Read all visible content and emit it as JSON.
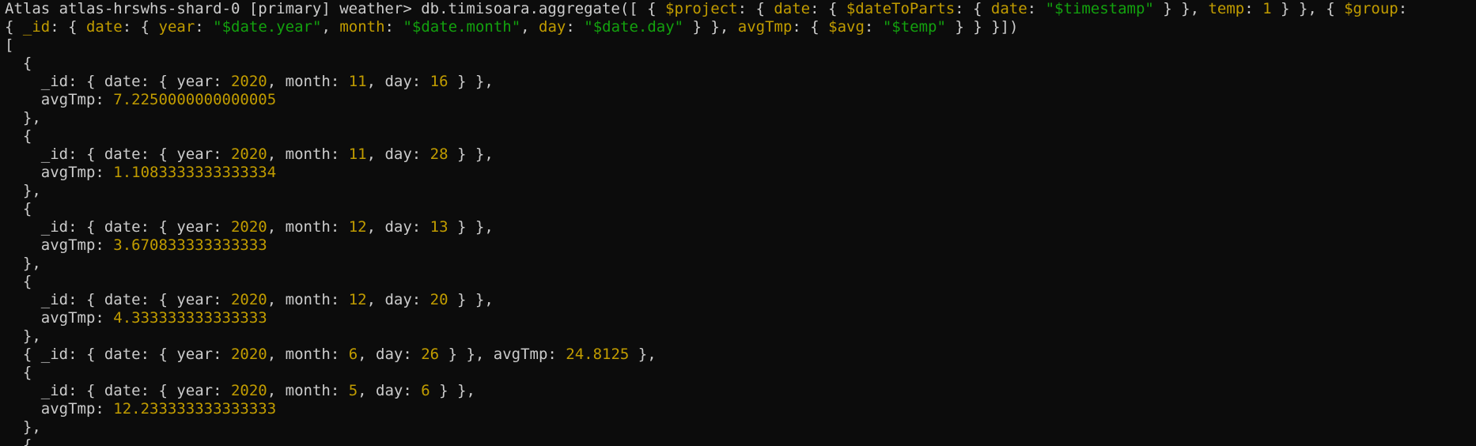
{
  "terminal": {
    "colors": {
      "background": "#0c0c0c",
      "plain": "#cccccc",
      "key": "#c19c00",
      "number": "#c19c00",
      "string": "#13a10e"
    },
    "lines": [
      [
        {
          "t": "Atlas atlas-hrswhs-shard-0 [primary] weather> db.timisoara.aggregate([ { ",
          "c": "plain"
        },
        {
          "t": "$project",
          "c": "key"
        },
        {
          "t": ": { ",
          "c": "plain"
        },
        {
          "t": "date",
          "c": "key"
        },
        {
          "t": ": { ",
          "c": "plain"
        },
        {
          "t": "$dateToParts",
          "c": "key"
        },
        {
          "t": ": { ",
          "c": "plain"
        },
        {
          "t": "date",
          "c": "key"
        },
        {
          "t": ": ",
          "c": "plain"
        },
        {
          "t": "\"$timestamp\"",
          "c": "string"
        },
        {
          "t": " } }, ",
          "c": "plain"
        },
        {
          "t": "temp",
          "c": "key"
        },
        {
          "t": ": ",
          "c": "plain"
        },
        {
          "t": "1",
          "c": "number"
        },
        {
          "t": " } }, { ",
          "c": "plain"
        },
        {
          "t": "$group",
          "c": "key"
        },
        {
          "t": ":",
          "c": "plain"
        }
      ],
      [
        {
          "t": "{ ",
          "c": "plain"
        },
        {
          "t": "_id",
          "c": "key"
        },
        {
          "t": ": { ",
          "c": "plain"
        },
        {
          "t": "date",
          "c": "key"
        },
        {
          "t": ": { ",
          "c": "plain"
        },
        {
          "t": "year",
          "c": "key"
        },
        {
          "t": ": ",
          "c": "plain"
        },
        {
          "t": "\"$date.year\"",
          "c": "string"
        },
        {
          "t": ", ",
          "c": "plain"
        },
        {
          "t": "month",
          "c": "key"
        },
        {
          "t": ": ",
          "c": "plain"
        },
        {
          "t": "\"$date.month\"",
          "c": "string"
        },
        {
          "t": ", ",
          "c": "plain"
        },
        {
          "t": "day",
          "c": "key"
        },
        {
          "t": ": ",
          "c": "plain"
        },
        {
          "t": "\"$date.day\"",
          "c": "string"
        },
        {
          "t": " } }, ",
          "c": "plain"
        },
        {
          "t": "avgTmp",
          "c": "key"
        },
        {
          "t": ": { ",
          "c": "plain"
        },
        {
          "t": "$avg",
          "c": "key"
        },
        {
          "t": ": ",
          "c": "plain"
        },
        {
          "t": "\"$temp\"",
          "c": "string"
        },
        {
          "t": " } } }])",
          "c": "plain"
        }
      ],
      [
        {
          "t": "[",
          "c": "plain"
        }
      ],
      [
        {
          "t": "  {",
          "c": "plain"
        }
      ],
      [
        {
          "t": "    _id: { date: { year: ",
          "c": "plain"
        },
        {
          "t": "2020",
          "c": "number"
        },
        {
          "t": ", month: ",
          "c": "plain"
        },
        {
          "t": "11",
          "c": "number"
        },
        {
          "t": ", day: ",
          "c": "plain"
        },
        {
          "t": "16",
          "c": "number"
        },
        {
          "t": " } },",
          "c": "plain"
        }
      ],
      [
        {
          "t": "    avgTmp: ",
          "c": "plain"
        },
        {
          "t": "7.2250000000000005",
          "c": "number"
        }
      ],
      [
        {
          "t": "  },",
          "c": "plain"
        }
      ],
      [
        {
          "t": "  {",
          "c": "plain"
        }
      ],
      [
        {
          "t": "    _id: { date: { year: ",
          "c": "plain"
        },
        {
          "t": "2020",
          "c": "number"
        },
        {
          "t": ", month: ",
          "c": "plain"
        },
        {
          "t": "11",
          "c": "number"
        },
        {
          "t": ", day: ",
          "c": "plain"
        },
        {
          "t": "28",
          "c": "number"
        },
        {
          "t": " } },",
          "c": "plain"
        }
      ],
      [
        {
          "t": "    avgTmp: ",
          "c": "plain"
        },
        {
          "t": "1.1083333333333334",
          "c": "number"
        }
      ],
      [
        {
          "t": "  },",
          "c": "plain"
        }
      ],
      [
        {
          "t": "  {",
          "c": "plain"
        }
      ],
      [
        {
          "t": "    _id: { date: { year: ",
          "c": "plain"
        },
        {
          "t": "2020",
          "c": "number"
        },
        {
          "t": ", month: ",
          "c": "plain"
        },
        {
          "t": "12",
          "c": "number"
        },
        {
          "t": ", day: ",
          "c": "plain"
        },
        {
          "t": "13",
          "c": "number"
        },
        {
          "t": " } },",
          "c": "plain"
        }
      ],
      [
        {
          "t": "    avgTmp: ",
          "c": "plain"
        },
        {
          "t": "3.670833333333333",
          "c": "number"
        }
      ],
      [
        {
          "t": "  },",
          "c": "plain"
        }
      ],
      [
        {
          "t": "  {",
          "c": "plain"
        }
      ],
      [
        {
          "t": "    _id: { date: { year: ",
          "c": "plain"
        },
        {
          "t": "2020",
          "c": "number"
        },
        {
          "t": ", month: ",
          "c": "plain"
        },
        {
          "t": "12",
          "c": "number"
        },
        {
          "t": ", day: ",
          "c": "plain"
        },
        {
          "t": "20",
          "c": "number"
        },
        {
          "t": " } },",
          "c": "plain"
        }
      ],
      [
        {
          "t": "    avgTmp: ",
          "c": "plain"
        },
        {
          "t": "4.333333333333333",
          "c": "number"
        }
      ],
      [
        {
          "t": "  },",
          "c": "plain"
        }
      ],
      [
        {
          "t": "  { _id: { date: { year: ",
          "c": "plain"
        },
        {
          "t": "2020",
          "c": "number"
        },
        {
          "t": ", month: ",
          "c": "plain"
        },
        {
          "t": "6",
          "c": "number"
        },
        {
          "t": ", day: ",
          "c": "plain"
        },
        {
          "t": "26",
          "c": "number"
        },
        {
          "t": " } }, avgTmp: ",
          "c": "plain"
        },
        {
          "t": "24.8125",
          "c": "number"
        },
        {
          "t": " },",
          "c": "plain"
        }
      ],
      [
        {
          "t": "  {",
          "c": "plain"
        }
      ],
      [
        {
          "t": "    _id: { date: { year: ",
          "c": "plain"
        },
        {
          "t": "2020",
          "c": "number"
        },
        {
          "t": ", month: ",
          "c": "plain"
        },
        {
          "t": "5",
          "c": "number"
        },
        {
          "t": ", day: ",
          "c": "plain"
        },
        {
          "t": "6",
          "c": "number"
        },
        {
          "t": " } },",
          "c": "plain"
        }
      ],
      [
        {
          "t": "    avgTmp: ",
          "c": "plain"
        },
        {
          "t": "12.233333333333333",
          "c": "number"
        }
      ],
      [
        {
          "t": "  },",
          "c": "plain"
        }
      ],
      [
        {
          "t": "  {",
          "c": "plain"
        }
      ]
    ]
  }
}
